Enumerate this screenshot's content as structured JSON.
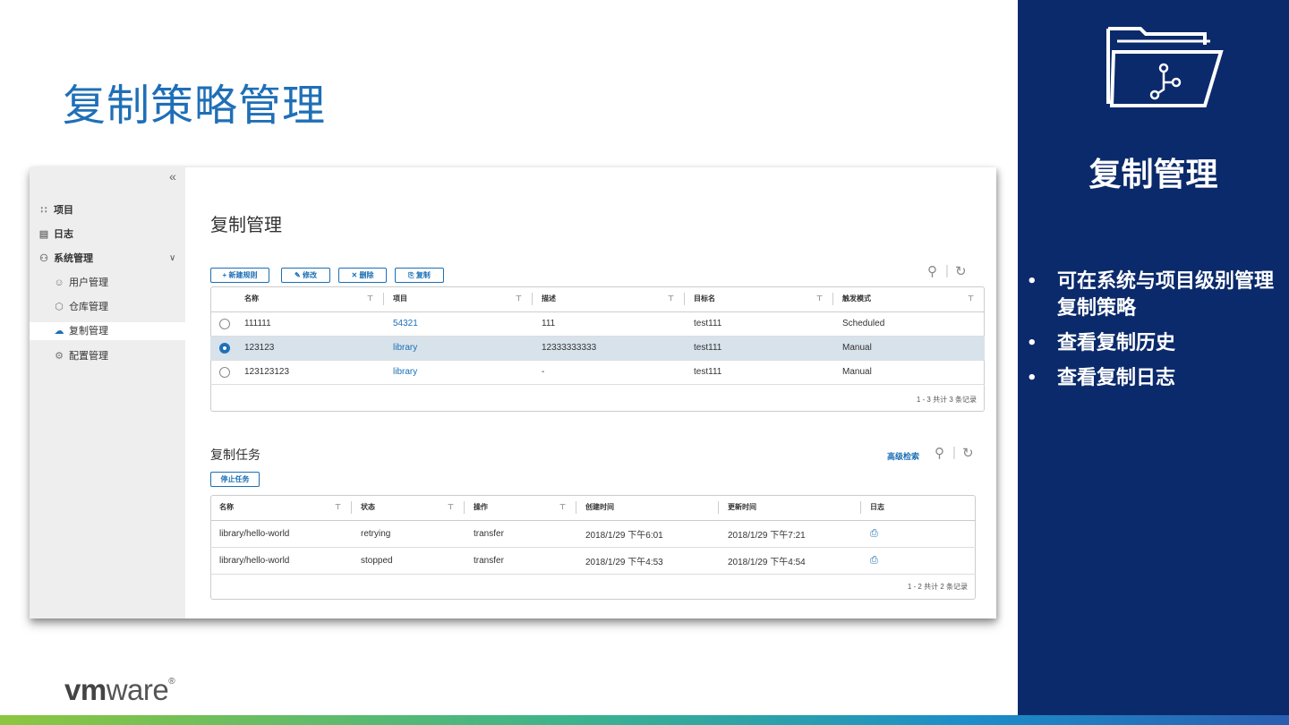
{
  "slide": {
    "title": "复制策略管理"
  },
  "right_panel": {
    "title": "复制管理",
    "icon": "folder-branch-icon",
    "bullets": [
      "可在系统与项目级别管理复制策略",
      "查看复制历史",
      "查看复制日志"
    ]
  },
  "logo": {
    "text_bold": "vm",
    "text": "ware",
    "mark": "®"
  },
  "colors": {
    "brand_blue": "#1f6fb7",
    "panel_navy": "#0b2a6b",
    "link_blue": "#1a6fb5"
  },
  "app": {
    "collapse_glyph": "«",
    "sidebar": {
      "items": [
        {
          "label": "项目",
          "icon": "projects-icon"
        },
        {
          "label": "日志",
          "icon": "logs-icon"
        },
        {
          "label": "系统管理",
          "icon": "admin-icon"
        }
      ],
      "sub_items": [
        {
          "label": "用户管理",
          "icon": "users-icon"
        },
        {
          "label": "仓库管理",
          "icon": "registry-icon"
        },
        {
          "label": "复制管理",
          "icon": "cloud-icon",
          "active": true
        },
        {
          "label": "配置管理",
          "icon": "settings-icon"
        }
      ]
    },
    "page_title": "复制管理",
    "toolbar": {
      "new_rule": "+ 新建规则",
      "edit": "修改",
      "delete": "删除",
      "copy": "复制"
    },
    "rules_table": {
      "columns": [
        "名称",
        "项目",
        "描述",
        "目标名",
        "触发模式"
      ],
      "rows": [
        {
          "name": "111111",
          "project": "54321",
          "desc": "111",
          "target": "test111",
          "trigger": "Scheduled",
          "selected": false
        },
        {
          "name": "123123",
          "project": "library",
          "desc": "12333333333",
          "target": "test111",
          "trigger": "Manual",
          "selected": true
        },
        {
          "name": "123123123",
          "project": "library",
          "desc": "-",
          "target": "test111",
          "trigger": "Manual",
          "selected": false
        }
      ],
      "footer": "1 - 3 共计 3 条记录"
    },
    "jobs": {
      "title": "复制任务",
      "advanced_search": "高级检索",
      "stop_button": "停止任务",
      "columns": [
        "名称",
        "状态",
        "操作",
        "创建时间",
        "更新时间",
        "日志"
      ],
      "rows": [
        {
          "name": "library/hello-world",
          "status": "retrying",
          "op": "transfer",
          "created": "2018/1/29 下午6:01",
          "updated": "2018/1/29 下午7:21"
        },
        {
          "name": "library/hello-world",
          "status": "stopped",
          "op": "transfer",
          "created": "2018/1/29 下午4:53",
          "updated": "2018/1/29 下午4:54"
        }
      ],
      "footer": "1 - 2 共计 2 条记录"
    }
  }
}
